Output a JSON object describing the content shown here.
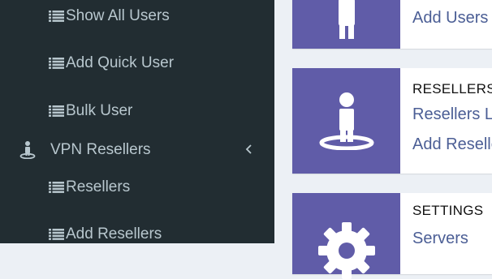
{
  "sidebar": {
    "show_all_users": "Show All Users",
    "add_quick_user": "Add Quick User",
    "bulk_user": "Bulk User",
    "vpn_resellers": "VPN Resellers",
    "resellers": "Resellers",
    "add_resellers": "Add Resellers"
  },
  "boxes": {
    "users": {
      "link": "Add Users"
    },
    "resellers": {
      "title": "RESELLERS",
      "link1": "Resellers L",
      "link2": "Add Reselle"
    },
    "settings": {
      "title": "SETTINGS",
      "link1": "Servers"
    }
  },
  "colors": {
    "sidebar_bg": "#222d32",
    "sidebar_text": "#b8c7ce",
    "accent_purple": "#605ca8",
    "link": "#4b5e95",
    "content_bg": "#ecf0f5"
  }
}
